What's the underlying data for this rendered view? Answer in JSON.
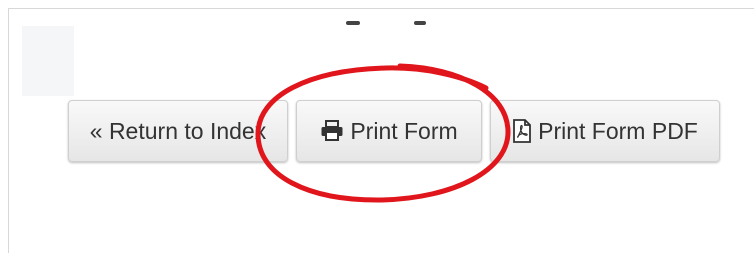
{
  "buttons": {
    "return_label": "« Return to Index",
    "print_label": "Print Form",
    "print_pdf_label": "Print Form PDF"
  },
  "icons": {
    "print": "printer-icon",
    "pdf": "pdf-file-icon"
  },
  "colors": {
    "annotation": "#e0161c",
    "button_text": "#333333"
  }
}
